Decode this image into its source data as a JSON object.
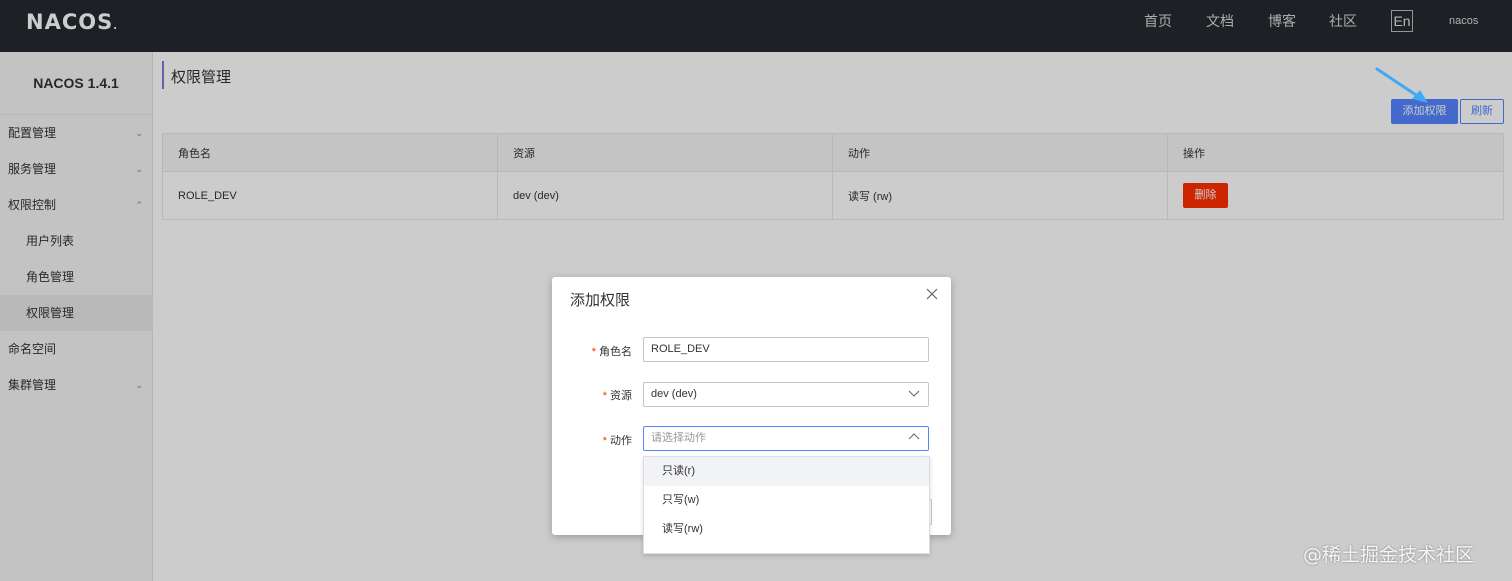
{
  "header": {
    "logo": "NACOS",
    "nav": [
      "首页",
      "文档",
      "博客",
      "社区"
    ],
    "lang": "En",
    "user": "nacos"
  },
  "sidebar": {
    "title": "NACOS 1.4.1",
    "items": [
      {
        "label": "配置管理"
      },
      {
        "label": "服务管理"
      },
      {
        "label": "权限控制"
      },
      {
        "label": "用户列表"
      },
      {
        "label": "角色管理"
      },
      {
        "label": "权限管理"
      },
      {
        "label": "命名空间"
      },
      {
        "label": "集群管理"
      }
    ]
  },
  "page": {
    "title": "权限管理",
    "add_button": "添加权限",
    "refresh_button": "刷新"
  },
  "table": {
    "headers": [
      "角色名",
      "资源",
      "动作",
      "操作"
    ],
    "rows": [
      {
        "role": "ROLE_DEV",
        "resource": "dev (dev)",
        "action": "读写 (rw)",
        "op": "删除"
      }
    ]
  },
  "dialog": {
    "title": "添加权限",
    "fields": {
      "role_label": "角色名",
      "role_value": "ROLE_DEV",
      "resource_label": "资源",
      "resource_value": "dev (dev)",
      "action_label": "动作",
      "action_placeholder": "请选择动作"
    },
    "options": [
      "只读(r)",
      "只写(w)",
      "读写(rw)"
    ]
  },
  "watermark": "@稀土掘金技术社区",
  "colors": {
    "topbar": "#252a2f",
    "primary": "#5584ff",
    "danger": "#ff3000",
    "required": "#ff3000"
  }
}
